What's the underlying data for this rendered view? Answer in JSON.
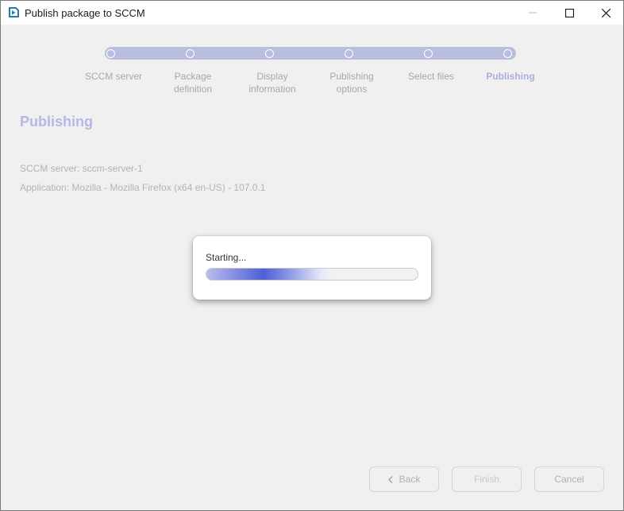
{
  "window": {
    "title": "Publish package to SCCM",
    "app_icon": "publish-app-icon"
  },
  "stepper": {
    "steps": [
      {
        "label": "SCCM server",
        "active": false
      },
      {
        "label": "Package\ndefinition",
        "active": false
      },
      {
        "label": "Display\ninformation",
        "active": false
      },
      {
        "label": "Publishing\noptions",
        "active": false
      },
      {
        "label": "Select files",
        "active": false
      },
      {
        "label": "Publishing",
        "active": true
      }
    ]
  },
  "page": {
    "heading": "Publishing",
    "server_line": "SCCM server: sccm-server-1",
    "application_line": "Application: Mozilla - Mozilla Firefox (x64 en-US) - 107.0.1"
  },
  "progress": {
    "status": "Starting...",
    "fraction": 0.6
  },
  "footer": {
    "back_label": "Back",
    "finish_label": "Finish",
    "cancel_label": "Cancel"
  },
  "colors": {
    "accent": "#4d5fd6",
    "stepper_track": "#b9bedf",
    "heading": "#b4b8e6"
  }
}
